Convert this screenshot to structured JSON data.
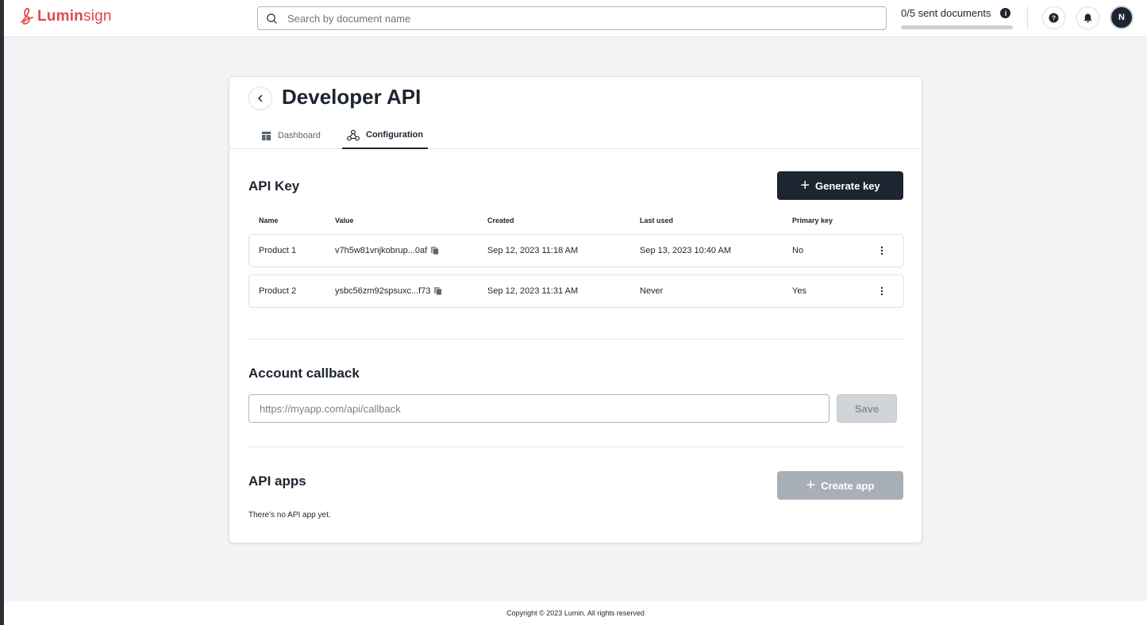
{
  "app": {
    "logo_text_bold": "Lumin",
    "logo_text_light": "sign",
    "brand_color": "#e0474c"
  },
  "search": {
    "placeholder": "Search by document name"
  },
  "quota": {
    "label": "0/5 sent documents",
    "sent": 0,
    "total": 5
  },
  "user": {
    "initial": "N"
  },
  "page": {
    "title": "Developer API",
    "tabs": [
      {
        "label": "Dashboard",
        "icon": "dashboard-icon",
        "active": false
      },
      {
        "label": "Configuration",
        "icon": "webhook-icon",
        "active": true
      }
    ]
  },
  "api_key": {
    "title": "API Key",
    "generate_label": "Generate key",
    "columns": [
      "Name",
      "Value",
      "Created",
      "Last used",
      "Primary key"
    ],
    "rows": [
      {
        "name": "Product 1",
        "value": "v7h5w81vnjkobrup...0af",
        "created": "Sep 12, 2023 11:18 AM",
        "last_used": "Sep 13, 2023 10:40 AM",
        "primary": "No"
      },
      {
        "name": "Product 2",
        "value": "ysbc56zm92spsuxc...f73",
        "created": "Sep 12, 2023 11:31 AM",
        "last_used": "Never",
        "primary": "Yes"
      }
    ]
  },
  "callback": {
    "title": "Account callback",
    "placeholder": "https://myapp.com/api/callback",
    "value": "",
    "save_label": "Save"
  },
  "api_apps": {
    "title": "API apps",
    "create_label": "Create app",
    "empty_text": "There's no API app yet."
  },
  "footer": {
    "text": "Copyright © 2023 Lumin. All rights reserved"
  }
}
